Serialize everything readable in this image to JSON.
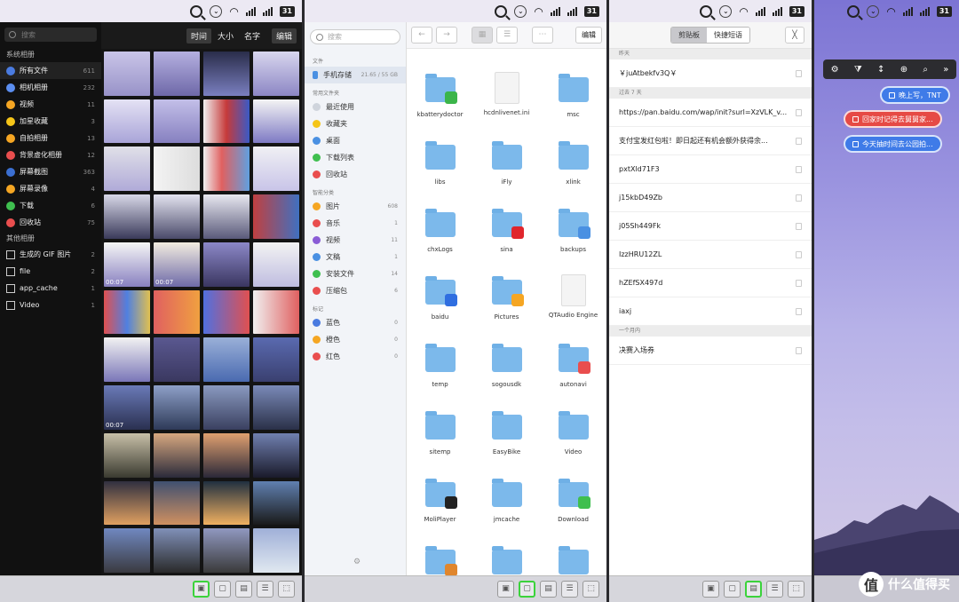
{
  "status": {
    "battery": "31",
    "wifi": "◠",
    "chevron": "⌄"
  },
  "gallery": {
    "search_placeholder": "搜索",
    "sort": [
      "时间",
      "大小",
      "名字"
    ],
    "edit": "编辑",
    "system_section": "系统相册",
    "system_items": [
      {
        "label": "所有文件",
        "count": "611",
        "color": "#4a7be0"
      },
      {
        "label": "相机相册",
        "count": "232",
        "color": "#5b8ef0"
      },
      {
        "label": "视频",
        "count": "11",
        "color": "#f5a623"
      },
      {
        "label": "加星收藏",
        "count": "3",
        "color": "#f5c518"
      },
      {
        "label": "自拍相册",
        "count": "13",
        "color": "#f5a623"
      },
      {
        "label": "背景虚化相册",
        "count": "12",
        "color": "#e94e4e"
      },
      {
        "label": "屏幕截图",
        "count": "363",
        "color": "#3b6fd1"
      },
      {
        "label": "屏幕录像",
        "count": "4",
        "color": "#f5a623"
      },
      {
        "label": "下载",
        "count": "6",
        "color": "#3fbf4f"
      },
      {
        "label": "回收站",
        "count": "75",
        "color": "#e94e4e"
      }
    ],
    "other_section": "其他相册",
    "other_items": [
      {
        "label": "生成的 GIF 图片",
        "count": "2"
      },
      {
        "label": "file",
        "count": "2"
      },
      {
        "label": "app_cache",
        "count": "1"
      },
      {
        "label": "Video",
        "count": "1"
      }
    ],
    "video_durations": [
      "00:07",
      "00:07",
      "00:07"
    ]
  },
  "files": {
    "search_placeholder": "搜索",
    "edit": "编辑",
    "section_files": "文件",
    "storage": {
      "label": "手机存储",
      "size": "21.65 / 55 GB"
    },
    "section_common": "常用文件夹",
    "common": [
      {
        "label": "最近使用",
        "color": "#cfd4dc"
      },
      {
        "label": "收藏夹",
        "color": "#f5c518"
      },
      {
        "label": "桌面",
        "color": "#4a90e2"
      },
      {
        "label": "下载列表",
        "color": "#3fbf4f"
      },
      {
        "label": "回收站",
        "color": "#e94e4e"
      }
    ],
    "section_smart": "智能分类",
    "smart": [
      {
        "label": "图片",
        "count": "608",
        "color": "#f5a623"
      },
      {
        "label": "音乐",
        "count": "1",
        "color": "#e94e4e"
      },
      {
        "label": "视频",
        "count": "11",
        "color": "#8a5cd6"
      },
      {
        "label": "文稿",
        "count": "1",
        "color": "#4a90e2"
      },
      {
        "label": "安装文件",
        "count": "14",
        "color": "#3fbf4f"
      },
      {
        "label": "压缩包",
        "count": "6",
        "color": "#e94e4e"
      }
    ],
    "section_tags": "标记",
    "tags": [
      {
        "label": "蓝色",
        "count": "0",
        "color": "#4a7be0"
      },
      {
        "label": "橙色",
        "count": "0",
        "color": "#f5a623"
      },
      {
        "label": "红色",
        "count": "0",
        "color": "#e94e4e"
      }
    ],
    "grid": [
      {
        "name": "kbatterydoctor",
        "kind": "folder",
        "badge": "#3bb54a"
      },
      {
        "name": "hcdnlivenet.ini",
        "kind": "doc"
      },
      {
        "name": "msc",
        "kind": "folder"
      },
      {
        "name": "libs",
        "kind": "folder"
      },
      {
        "name": "iFly",
        "kind": "folder"
      },
      {
        "name": "xlink",
        "kind": "folder"
      },
      {
        "name": "chxLogs",
        "kind": "folder"
      },
      {
        "name": "sina",
        "kind": "folder",
        "badge": "#e0262d"
      },
      {
        "name": "backups",
        "kind": "folder",
        "badge": "#4a90e2"
      },
      {
        "name": "baidu",
        "kind": "folder",
        "badge": "#2f6ee0"
      },
      {
        "name": "Pictures",
        "kind": "folder",
        "badge": "#f5a623"
      },
      {
        "name": "QTAudio Engine",
        "kind": "doc"
      },
      {
        "name": "temp",
        "kind": "folder"
      },
      {
        "name": "sogousdk",
        "kind": "folder"
      },
      {
        "name": "autonavi",
        "kind": "folder",
        "badge": "#e94e4e"
      },
      {
        "name": "sitemp",
        "kind": "folder"
      },
      {
        "name": "EasyBike",
        "kind": "folder"
      },
      {
        "name": "Video",
        "kind": "folder"
      },
      {
        "name": "MoliPlayer",
        "kind": "folder",
        "badge": "#222"
      },
      {
        "name": "jmcache",
        "kind": "folder"
      },
      {
        "name": "Download",
        "kind": "folder",
        "badge": "#3fbf4f"
      },
      {
        "name": "",
        "kind": "folder",
        "badge": "#e0862d"
      },
      {
        "name": "",
        "kind": "folder"
      },
      {
        "name": "",
        "kind": "folder"
      }
    ]
  },
  "clipboard": {
    "tabs": [
      "剪贴板",
      "快捷短语"
    ],
    "groups": [
      {
        "header": "昨天",
        "items": [
          "￥juAtbekfv3Q￥"
        ]
      },
      {
        "header": "过去 7 天",
        "items": [
          "https://pan.baidu.com/wap/init?surl=XzVLK_v...",
          "支付宝发红包啦！即日起还有机会额外获得余...",
          "pxtXld71F3",
          "j15kbD49Zb",
          "j05Sh449Fk",
          "IzzHRU12ZL",
          "hZEfSX497d",
          "iaxj"
        ]
      },
      {
        "header": "一个月内",
        "items": [
          "决赛入场券"
        ]
      }
    ]
  },
  "desktop": {
    "tools": [
      "⚙",
      "⧩",
      "↕",
      "⊕",
      "⌕",
      "»"
    ],
    "notes": [
      {
        "text": "晚上写，TNT",
        "color": "#3f7be8"
      },
      {
        "text": "回家时记得去舅舅家...",
        "color": "#e64a45"
      },
      {
        "text": "今天抽时间去公园拍...",
        "color": "#3f7be8"
      }
    ],
    "brand": "什么值得买",
    "brand_icon": "值"
  },
  "bottom_icons": [
    "▣",
    "▢",
    "▤",
    "☰",
    "⬚"
  ]
}
